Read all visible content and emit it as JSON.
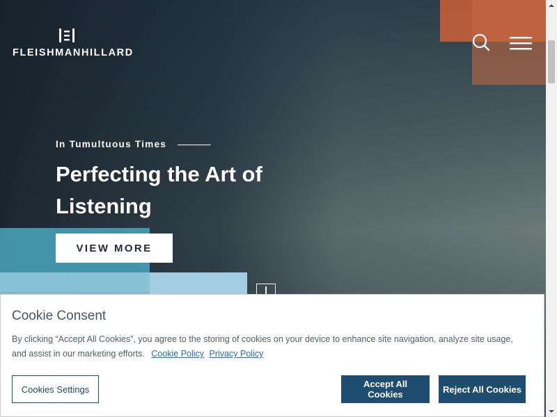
{
  "header": {
    "logo_text": "FLEISHMANHILLARD",
    "search_icon": "search-icon",
    "menu_icon": "hamburger-menu-icon"
  },
  "hero": {
    "eyebrow": "In Tumultuous Times",
    "headline": "Perfecting the Art of Listening",
    "cta_label": "VIEW MORE",
    "colors": {
      "accent_orange": "#c8603a",
      "accent_teal": "#4aa6bf",
      "accent_light_blue": "#8fc6dc"
    }
  },
  "cookie_banner": {
    "title": "Cookie Consent",
    "body": "By clicking “Accept All Cookies”, you agree to the storing of cookies on your device to enhance site navigation, analyze site usage, and assist in our marketing efforts.",
    "cookie_policy_link": "Cookie Policy",
    "privacy_policy_link": "Privacy Policy",
    "settings_label": "Cookies Settings",
    "accept_label": "Accept All Cookies",
    "reject_label": "Reject All Cookies",
    "colors": {
      "primary_button": "#1e4d70",
      "link": "#1f6fb2"
    }
  }
}
